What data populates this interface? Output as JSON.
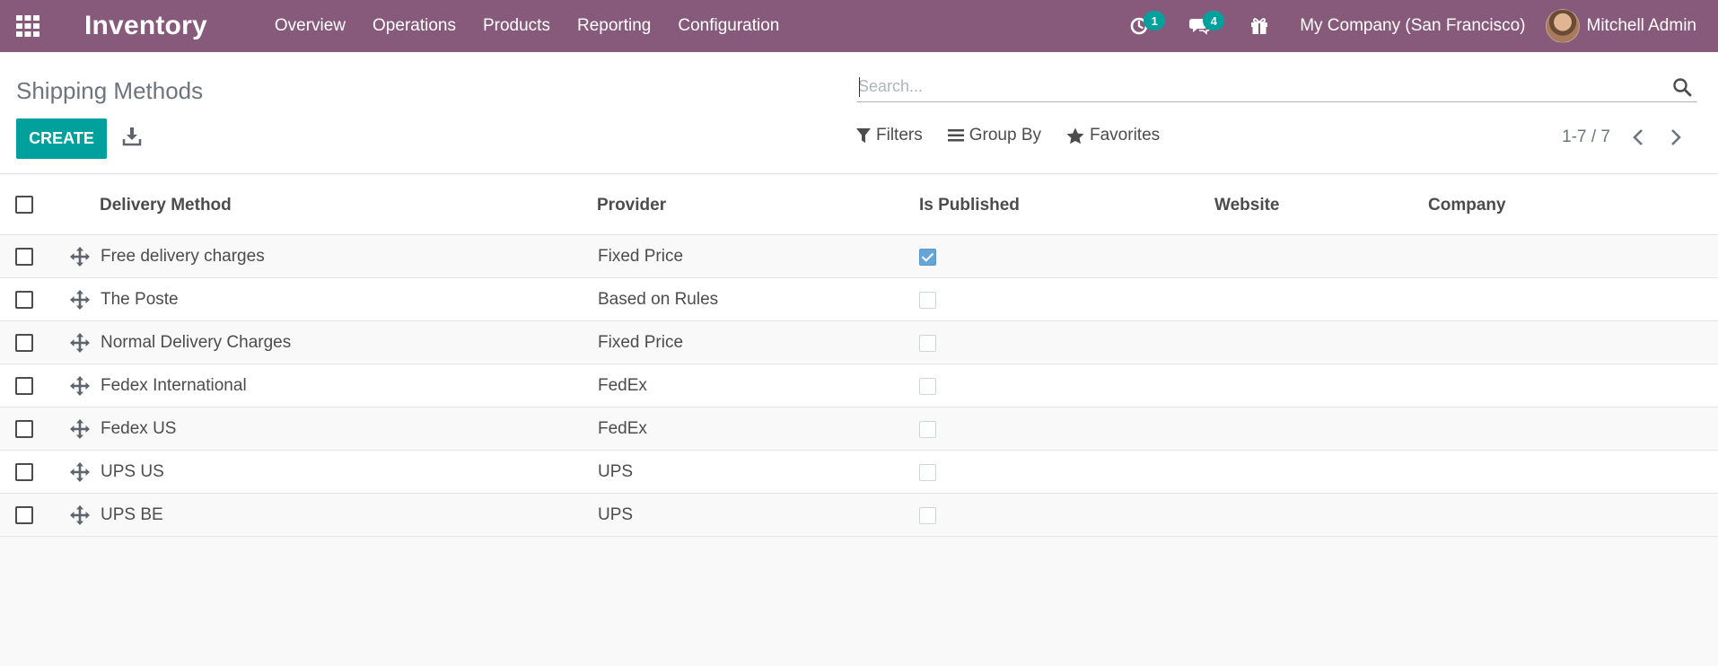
{
  "navbar": {
    "app_name": "Inventory",
    "menu": [
      "Overview",
      "Operations",
      "Products",
      "Reporting",
      "Configuration"
    ],
    "activity_count": "1",
    "messages_count": "4",
    "company": "My Company (San Francisco)",
    "user_name": "Mitchell Admin",
    "icons": [
      "apps-grid-icon",
      "clock-icon",
      "chat-icon",
      "gift-icon"
    ]
  },
  "control_panel": {
    "title": "Shipping Methods",
    "create_label": "CREATE",
    "search_placeholder": "Search...",
    "filters_label": "Filters",
    "group_by_label": "Group By",
    "favorites_label": "Favorites",
    "pager": "1-7 / 7"
  },
  "list": {
    "columns": [
      "Delivery Method",
      "Provider",
      "Is Published",
      "Website",
      "Company"
    ],
    "rows": [
      {
        "name": "Free delivery charges",
        "provider": "Fixed Price",
        "published": true
      },
      {
        "name": "The Poste",
        "provider": "Based on Rules",
        "published": false
      },
      {
        "name": "Normal Delivery Charges",
        "provider": "Fixed Price",
        "published": false
      },
      {
        "name": "Fedex International",
        "provider": "FedEx",
        "published": false
      },
      {
        "name": "Fedex US",
        "provider": "FedEx",
        "published": false
      },
      {
        "name": "UPS US",
        "provider": "UPS",
        "published": false
      },
      {
        "name": "UPS BE",
        "provider": "UPS",
        "published": false
      }
    ]
  },
  "colors": {
    "navbar": "#875a7b",
    "primary_button": "#00a09d",
    "badge": "#00a09d",
    "checked_box": "#66a6d6"
  }
}
